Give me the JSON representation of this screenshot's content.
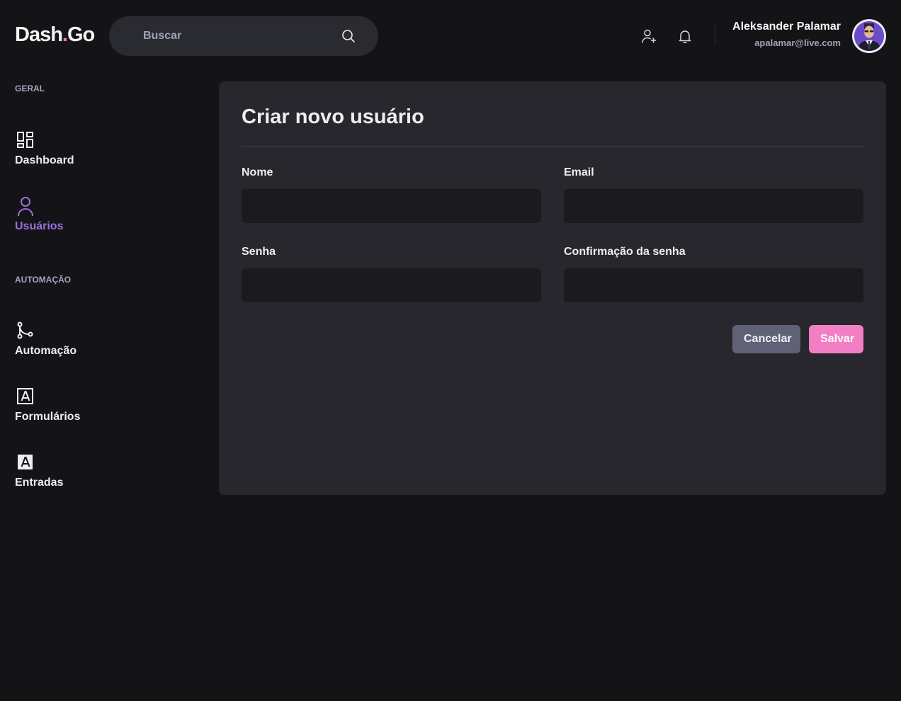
{
  "header": {
    "logo_main": "Dash",
    "logo_dot": ".",
    "logo_end": "Go",
    "search": {
      "placeholder": "Buscar"
    },
    "user": {
      "name": "Aleksander Palamar",
      "email": "apalamar@live.com"
    }
  },
  "sidebar": {
    "sections": [
      {
        "title": "GERAL",
        "items": [
          {
            "label": "Dashboard",
            "icon": "dashboard-icon",
            "active": false
          },
          {
            "label": "Usuários",
            "icon": "user-icon",
            "active": true
          }
        ]
      },
      {
        "title": "AUTOMAÇÃO",
        "items": [
          {
            "label": "Automação",
            "icon": "git-merge-icon",
            "active": false
          },
          {
            "label": "Formulários",
            "icon": "form-outline-icon",
            "active": false
          },
          {
            "label": "Entradas",
            "icon": "form-filled-icon",
            "active": false
          }
        ]
      }
    ]
  },
  "form": {
    "title": "Criar novo usuário",
    "fields": {
      "name": {
        "label": "Nome",
        "value": ""
      },
      "email": {
        "label": "Email",
        "value": ""
      },
      "password": {
        "label": "Senha",
        "value": ""
      },
      "password_confirmation": {
        "label": "Confirmação da senha",
        "value": ""
      }
    },
    "cancel_label": "Cancelar",
    "save_label": "Salvar"
  },
  "colors": {
    "background": "#141417",
    "card": "#27272D",
    "input": "#1A1A1F",
    "accent_pink": "#F27EC3",
    "accent_purple": "#9F6CE0",
    "cancel_button": "#5F6176"
  }
}
